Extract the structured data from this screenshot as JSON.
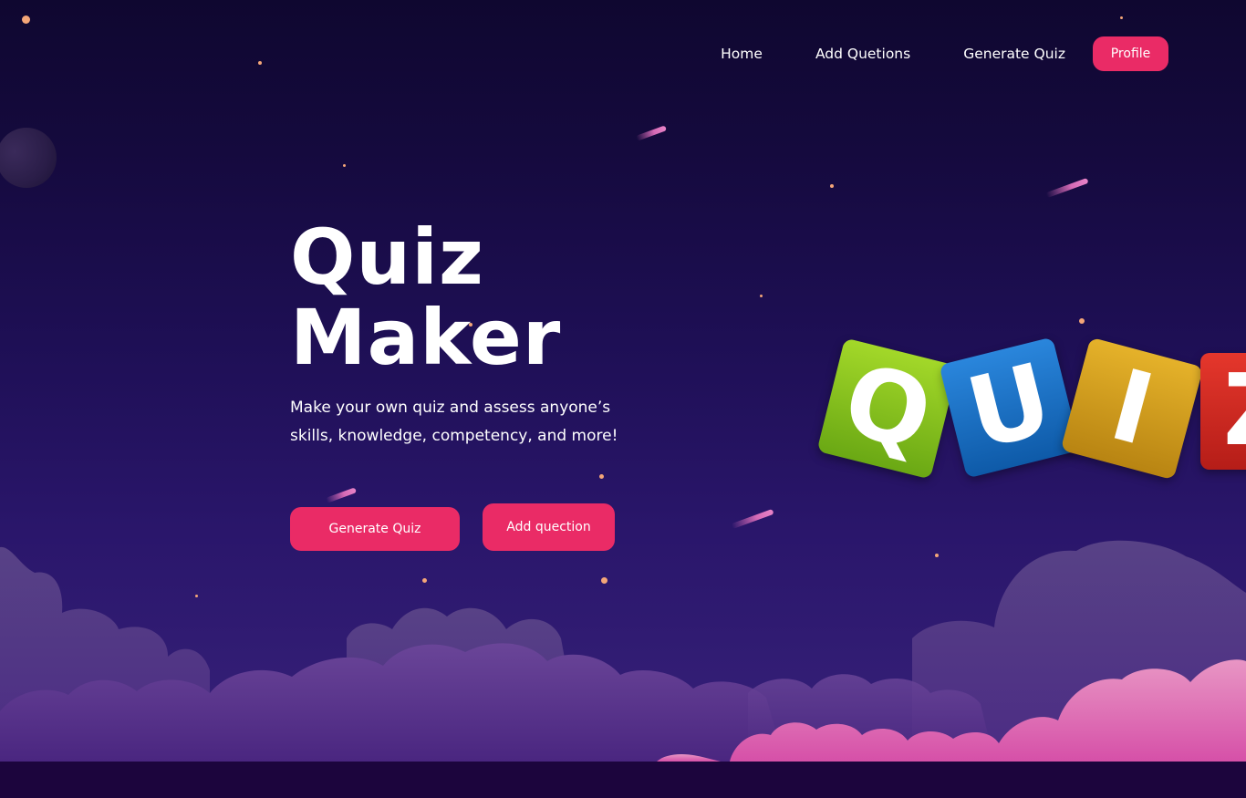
{
  "nav": {
    "links": [
      "Home",
      "Add Quetions",
      "Generate Quiz"
    ],
    "profile_label": "Profile"
  },
  "hero": {
    "title_line1": "Quiz",
    "title_line2": "Maker",
    "subtitle": "Make your own quiz and assess anyone’s skills, knowledge, competency, and more!",
    "primary_button": "Generate Quiz",
    "secondary_button": "Add quection"
  },
  "illustration": {
    "tiles": [
      {
        "letter": "Q",
        "color": "#7fbf1e"
      },
      {
        "letter": "U",
        "color": "#1670c8"
      },
      {
        "letter": "I",
        "color": "#d6a01e"
      },
      {
        "letter": "Z",
        "color": "#d22a24"
      }
    ]
  },
  "colors": {
    "accent": "#ea2b66",
    "background_top": "#0f0730",
    "background_bottom": "#37217a",
    "footer": "#1c053d"
  }
}
